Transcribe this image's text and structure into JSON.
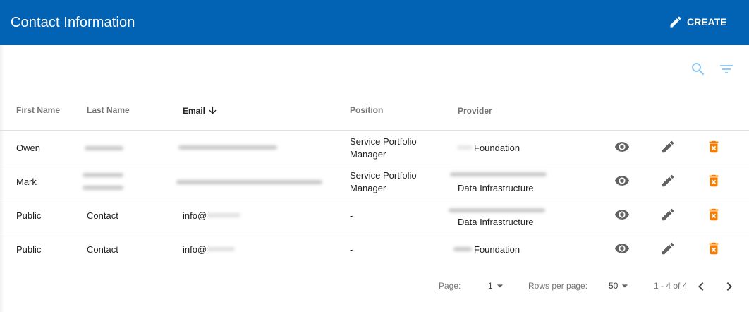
{
  "appbar": {
    "title": "Contact Information",
    "create_label": "CREATE"
  },
  "toolbar": {
    "icons": [
      "search-icon",
      "filter-icon"
    ],
    "icon_color": "#90caf9"
  },
  "columns": {
    "first_name": "First Name",
    "last_name": "Last Name",
    "email": "Email",
    "position": "Position",
    "provider": "Provider",
    "sort": "descending"
  },
  "rows": [
    {
      "first_name": "Owen",
      "last_name": "",
      "email": "",
      "position": "Service Portfolio\nManager",
      "provider": "Foundation"
    },
    {
      "first_name": "Mark",
      "last_name": "",
      "email": "",
      "position": "Service Portfolio\nManager",
      "provider": "Data Infrastructure"
    },
    {
      "first_name": "Public",
      "last_name": "Contact",
      "email": "info@",
      "position": "-",
      "provider": "Data Infrastructure"
    },
    {
      "first_name": "Public",
      "last_name": "Contact",
      "email": "info@",
      "position": "-",
      "provider": "Foundation"
    }
  ],
  "pagination": {
    "page_label": "Page:",
    "page_value": "1",
    "rows_label": "Rows per page:",
    "rows_value": "50",
    "range": "1 - 4 of 4"
  },
  "colors": {
    "primary": "#0263b5",
    "delete": "#f57c00",
    "action": "#616161"
  }
}
